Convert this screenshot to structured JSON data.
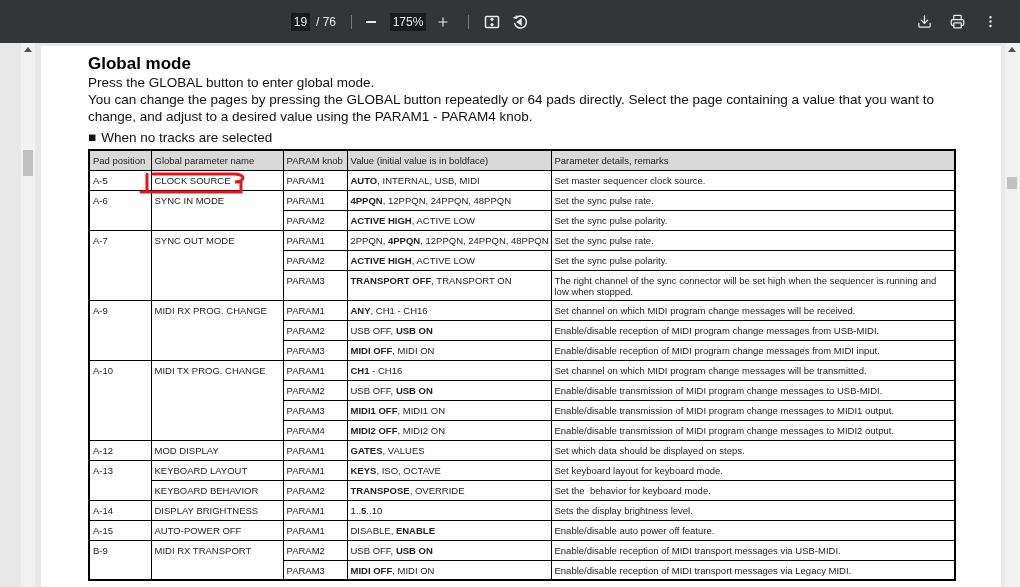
{
  "toolbar": {
    "page": "19",
    "page_count": "/ 76",
    "zoom": "175%"
  },
  "document": {
    "title": "Global mode",
    "paragraphs": [
      "Press the GLOBAL button to enter global mode.",
      "You can change the pages by pressing the GLOBAL button repeatedly or 64 pads directly. Select the page containing a value that you want to change, and adjust to a desired value using the PARAM1 - PARAM4 knob."
    ],
    "section_bullet": "■",
    "section": "When no tracks are selected",
    "table": {
      "columns": [
        "Pad position",
        "Global parameter name",
        "PARAM knob",
        "Value (initial value is in boldface)",
        "Parameter details, remarks"
      ],
      "groups": [
        {
          "pad": "A-5",
          "names": [
            {
              "name": "CLOCK SOURCE",
              "params": [
                {
                  "knob": "PARAM1",
                  "value": "**AUTO**, INTERNAL, USB, MIDI",
                  "remark": "Set master sequencer clock source."
                }
              ]
            }
          ]
        },
        {
          "pad": "A-6",
          "names": [
            {
              "name": "SYNC IN MODE",
              "params": [
                {
                  "knob": "PARAM1",
                  "value": "**4PPQN**, 12PPQN, 24PPQN, 48PPQN",
                  "remark": "Set the sync pulse rate."
                },
                {
                  "knob": "PARAM2",
                  "value": "**ACTIVE HIGH**, ACTIVE LOW",
                  "remark": "Set the sync pulse polarity."
                }
              ]
            }
          ]
        },
        {
          "pad": "A-7",
          "names": [
            {
              "name": "SYNC OUT MODE",
              "params": [
                {
                  "knob": "PARAM1",
                  "value": "2PPQN, **4PPQN**, 12PPQN, 24PPQN, 48PPQN",
                  "remark": "Set the sync pulse rate."
                },
                {
                  "knob": "PARAM2",
                  "value": "**ACTIVE HIGH**, ACTIVE LOW",
                  "remark": "Set the sync pulse polarity."
                },
                {
                  "knob": "PARAM3",
                  "value": "**TRANSPORT OFF**, TRANSPORT ON",
                  "remark": "The right channel of the sync connector will be set high when the sequencer is running and low when stopped."
                }
              ]
            }
          ]
        },
        {
          "pad": "A-9",
          "names": [
            {
              "name": "MIDI RX PROG. CHANGE",
              "params": [
                {
                  "knob": "PARAM1",
                  "value": "**ANY**, CH1 - CH16",
                  "remark": "Set channel on which MIDI program change messages will be received."
                },
                {
                  "knob": "PARAM2",
                  "value": "USB OFF, **USB ON**",
                  "remark": "Enable/disable reception of MIDI program change messages from USB-MIDI."
                },
                {
                  "knob": "PARAM3",
                  "value": "**MIDI OFF**, MIDI ON",
                  "remark": "Enable/disable reception of MIDI program change messages from MIDI input."
                }
              ]
            }
          ]
        },
        {
          "pad": "A-10",
          "names": [
            {
              "name": "MIDI TX PROG. CHANGE",
              "params": [
                {
                  "knob": "PARAM1",
                  "value": "**CH1** - CH16",
                  "remark": "Set channel on which MIDI program change messages will be transmitted."
                },
                {
                  "knob": "PARAM2",
                  "value": "USB OFF, **USB ON**",
                  "remark": "Enable/disable transmission of MIDI program change messages to USB-MIDI."
                },
                {
                  "knob": "PARAM3",
                  "value": "**MIDI1 OFF**, MIDI1 ON",
                  "remark": "Enable/disable transmission of MIDI program change messages to MIDI1 output."
                },
                {
                  "knob": "PARAM4",
                  "value": "**MIDI2 OFF**, MIDI2 ON",
                  "remark": "Enable/disable transmission of MIDI program change messages to MIDI2 output."
                }
              ]
            }
          ]
        },
        {
          "pad": "A-12",
          "names": [
            {
              "name": "MOD DISPLAY",
              "params": [
                {
                  "knob": "PARAM1",
                  "value": "**GATES**, VALUES",
                  "remark": "Set which data should be displayed on steps."
                }
              ]
            }
          ]
        },
        {
          "pad": "A-13",
          "names": [
            {
              "name": "KEYBOARD LAYOUT",
              "params": [
                {
                  "knob": "PARAM1",
                  "value": "**KEYS**, ISO, OCTAVE",
                  "remark": "Set keyboard layout for keyboard mode."
                }
              ]
            },
            {
              "name": "KEYBOARD BEHAVIOR",
              "params": [
                {
                  "knob": "PARAM2",
                  "value": "**TRANSPOSE**, OVERRIDE",
                  "remark": "Set the  behavior for keyboard mode."
                }
              ]
            }
          ]
        },
        {
          "pad": "A-14",
          "names": [
            {
              "name": "DISPLAY BRIGHTNESS",
              "params": [
                {
                  "knob": "PARAM1",
                  "value": "1..**5**..10",
                  "remark": "Sets the display brightness level."
                }
              ]
            }
          ]
        },
        {
          "pad": "A-15",
          "names": [
            {
              "name": "AUTO-POWER OFF",
              "params": [
                {
                  "knob": "PARAM1",
                  "value": "DISABLE, **ENABLE**",
                  "remark": "Enable/disable auto power off feature."
                }
              ]
            }
          ]
        },
        {
          "pad": "B-9",
          "names": [
            {
              "name": "MIDI RX TRANSPORT",
              "params": [
                {
                  "knob": "PARAM2",
                  "value": "USB OFF, **USB ON**",
                  "remark": "Enable/disable reception of MIDI transport messages via USB-MIDI."
                },
                {
                  "knob": "PARAM3",
                  "value": "**MIDI OFF**, MIDI ON",
                  "remark": "Enable/disable reception of MIDI transport messages via Legacy MIDI."
                }
              ]
            }
          ]
        }
      ]
    }
  }
}
